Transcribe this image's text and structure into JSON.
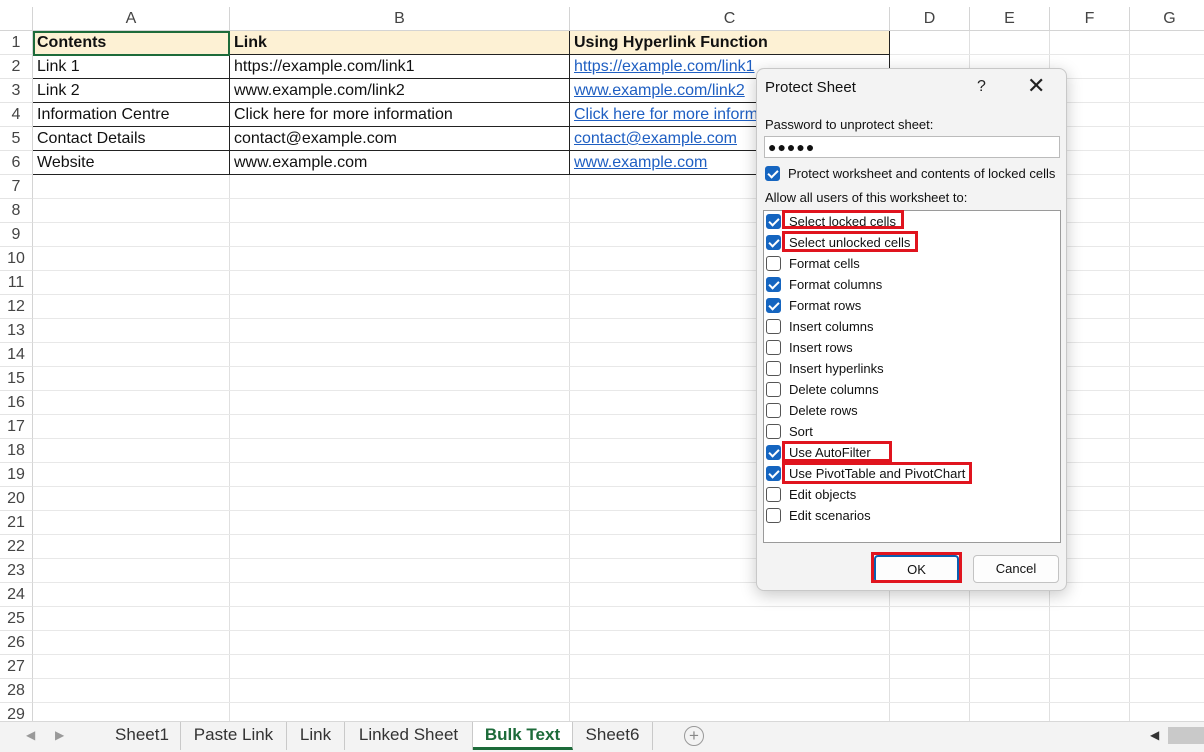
{
  "columns": [
    "A",
    "B",
    "C",
    "D",
    "E",
    "F",
    "G"
  ],
  "rows": [
    "1",
    "2",
    "3",
    "4",
    "5",
    "6",
    "7",
    "8",
    "9",
    "10",
    "11",
    "12",
    "13",
    "14",
    "15",
    "16",
    "17",
    "18",
    "19",
    "20",
    "21",
    "22",
    "23",
    "24",
    "25",
    "26",
    "27",
    "28",
    "29"
  ],
  "table": {
    "headers": [
      "Contents",
      "Link",
      "Using Hyperlink Function"
    ],
    "rows": [
      [
        "Link 1",
        "https://example.com/link1",
        "https://example.com/link1"
      ],
      [
        "Link 2",
        "www.example.com/link2",
        "www.example.com/link2"
      ],
      [
        "Information Centre",
        "Click here for more information",
        "Click here for more information"
      ],
      [
        "Contact Details",
        "contact@example.com",
        "contact@example.com"
      ],
      [
        "Website",
        "www.example.com",
        "www.example.com"
      ]
    ]
  },
  "sheet_tabs": [
    "Sheet1",
    "Paste Link",
    "Link",
    "Linked Sheet",
    "Bulk Text",
    "Sheet6"
  ],
  "active_tab": "Bulk Text",
  "dialog": {
    "title": "Protect Sheet",
    "help": "?",
    "close": "✕",
    "password_label": "Password to unprotect sheet:",
    "password_value": "●●●●●",
    "protect_label": "Protect worksheet and contents of locked cells",
    "protect_checked": true,
    "allow_label": "Allow all users of this worksheet to:",
    "permissions": [
      {
        "label": "Select locked cells",
        "checked": true
      },
      {
        "label": "Select unlocked cells",
        "checked": true
      },
      {
        "label": "Format cells",
        "checked": false
      },
      {
        "label": "Format columns",
        "checked": true
      },
      {
        "label": "Format rows",
        "checked": true
      },
      {
        "label": "Insert columns",
        "checked": false
      },
      {
        "label": "Insert rows",
        "checked": false
      },
      {
        "label": "Insert hyperlinks",
        "checked": false
      },
      {
        "label": "Delete columns",
        "checked": false
      },
      {
        "label": "Delete rows",
        "checked": false
      },
      {
        "label": "Sort",
        "checked": false
      },
      {
        "label": "Use AutoFilter",
        "checked": true
      },
      {
        "label": "Use PivotTable and PivotChart",
        "checked": true
      },
      {
        "label": "Edit objects",
        "checked": false
      },
      {
        "label": "Edit scenarios",
        "checked": false
      }
    ],
    "ok_label": "OK",
    "cancel_label": "Cancel"
  },
  "colors": {
    "highlight": "#e0141e",
    "accent": "#1565c0",
    "header_fill": "#fdf1d4",
    "active_tab": "#1d6b3a"
  }
}
